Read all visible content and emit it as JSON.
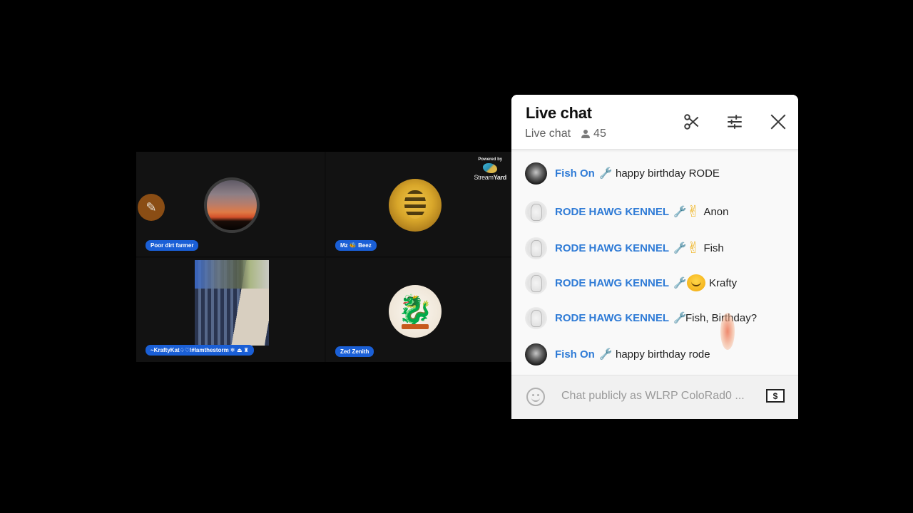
{
  "video_grid": {
    "participants": [
      {
        "name": "Poor dirt farmer",
        "avatar": "sunset-photo",
        "badge_icon": "paintbrush-icon"
      },
      {
        "name": "Mz 🐝 Beez",
        "avatar": "bee-logo"
      },
      {
        "name": "~KraftyKat♤♡/#Iamthestorm ❄ ⏏ ♜",
        "avatar": "video-feed-desk"
      },
      {
        "name": "Zed Zenith",
        "avatar": "dragon-logo"
      }
    ],
    "branding": {
      "powered_by": "Powered by",
      "brand_light": "Stream",
      "brand_bold": "Yard"
    }
  },
  "chat": {
    "title": "Live chat",
    "subtitle": "Live chat",
    "viewer_count": "45",
    "icons": {
      "scissors": "✂",
      "tune": "☰",
      "close": "✕",
      "wrench": "🔧",
      "person": "person-icon",
      "super_chat": "$"
    },
    "messages": [
      {
        "author": "Fish On",
        "avatar": "fish",
        "moderator": true,
        "emoji": "",
        "text": "happy birthday RODE"
      },
      {
        "author": "RODE HAWG KENNEL",
        "avatar": "rode",
        "moderator": true,
        "emoji": "✌",
        "text": "Anon"
      },
      {
        "author": "RODE HAWG KENNEL",
        "avatar": "rode",
        "moderator": true,
        "emoji": "✌",
        "text": "Fish"
      },
      {
        "author": "RODE HAWG KENNEL",
        "avatar": "rode",
        "moderator": true,
        "emoji": "🤗",
        "text": "Krafty"
      },
      {
        "author": "RODE HAWG KENNEL",
        "avatar": "rode",
        "moderator": true,
        "emoji": "",
        "text": "Fish, Birthday?"
      },
      {
        "author": "Fish On",
        "avatar": "fish",
        "moderator": true,
        "emoji": "",
        "text": "happy birthday rode"
      }
    ],
    "input": {
      "placeholder": "Chat publicly as WLRP ColoRad0 ..."
    }
  }
}
